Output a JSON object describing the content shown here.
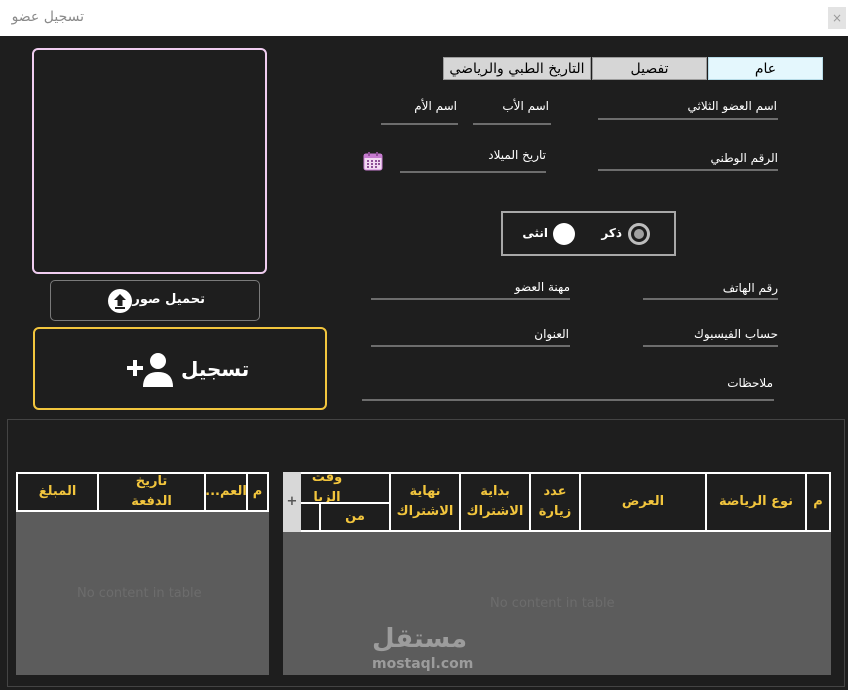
{
  "window": {
    "title": "تسجيل عضو",
    "close_symbol": "×"
  },
  "photo": {
    "upload_label": "تحميل صورة",
    "upload_icon": "upload-arrow-icon"
  },
  "register": {
    "label": "تسجيل",
    "icon": "add-user-icon"
  },
  "tabs": [
    {
      "label": "عام",
      "selected": true
    },
    {
      "label": "تفصيل",
      "selected": false
    },
    {
      "label": "التاريخ الطبي والرياضي",
      "selected": false
    }
  ],
  "form": {
    "full_name": {
      "label": "اسم العضو الثلاثي",
      "value": ""
    },
    "father_name": {
      "label": "اسم الأب",
      "value": ""
    },
    "mother_name": {
      "label": "اسم الأم",
      "value": ""
    },
    "national_id": {
      "label": "الرقم الوطني",
      "value": ""
    },
    "birth_date": {
      "label": "تاريخ الميلاد",
      "value": ""
    },
    "gender": {
      "male": "ذكر",
      "female": "انثى",
      "selected": "male"
    },
    "phone": {
      "label": "رقم الهاتف",
      "value": ""
    },
    "profession": {
      "label": "مهنة العضو",
      "value": ""
    },
    "facebook": {
      "label": "حساب الفيسبوك",
      "value": ""
    },
    "address": {
      "label": "العنوان",
      "value": ""
    },
    "notes": {
      "label": "ملاحظات",
      "value": ""
    }
  },
  "subscriptions_table": {
    "headers": {
      "index": "م",
      "sport_type": "نوع الرياضة",
      "offer": "العرض",
      "visits": "عدد زيارة",
      "start": "بداية الاشتراك",
      "end": "نهاية الاشتراك",
      "visit_time": "وقت الزيا",
      "visit_from": "من",
      "add_symbol": "+"
    },
    "rows": [],
    "empty_text": "No content in table"
  },
  "payments_table": {
    "headers": {
      "index": "م",
      "operation": "العم...",
      "payment_date": "تاريخ الدفعة",
      "amount": "المبلغ"
    },
    "rows": [],
    "empty_text": "No content in table"
  },
  "watermark": {
    "arabic": "مستقل",
    "latin": "mostaql.com"
  },
  "colors": {
    "accent": "#f2c53d",
    "photo_border": "#f0cdf0",
    "tab_selected": "#e4f7fd",
    "background": "#1e1e1e"
  }
}
